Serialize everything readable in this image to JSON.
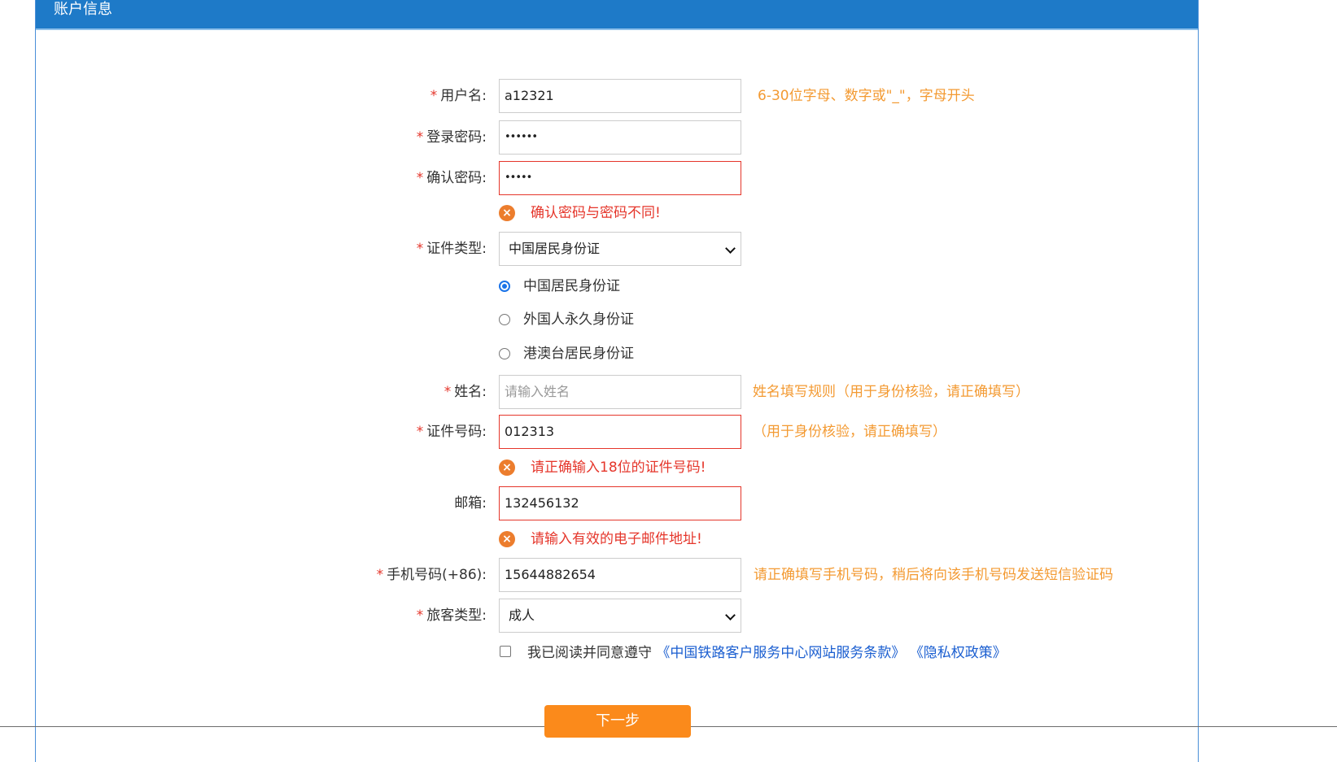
{
  "header": {
    "title": "账户信息"
  },
  "form": {
    "username": {
      "label": "用户名:",
      "value": "a12321",
      "hint": "6-30位字母、数字或\"_\"，字母开头"
    },
    "password": {
      "label": "登录密码:",
      "value": "••••••"
    },
    "confirm_password": {
      "label": "确认密码:",
      "value": "•••••",
      "error": "确认密码与密码不同!"
    },
    "id_type": {
      "label": "证件类型:",
      "value": "中国居民身份证",
      "options": [
        "中国居民身份证",
        "外国人永久身份证",
        "港澳台居民身份证"
      ],
      "selected_index": 0
    },
    "name": {
      "label": "姓名:",
      "placeholder": "请输入姓名",
      "hint": "姓名填写规则（用于身份核验，请正确填写）"
    },
    "id_number": {
      "label": "证件号码:",
      "value": "012313",
      "hint": "（用于身份核验，请正确填写）",
      "error": "请正确输入18位的证件号码!"
    },
    "email": {
      "label": "邮箱:",
      "value": "132456132",
      "error": "请输入有效的电子邮件地址!"
    },
    "phone": {
      "label": "手机号码(+86):",
      "value": "15644882654",
      "hint": "请正确填写手机号码，稍后将向该手机号码发送短信验证码"
    },
    "passenger_type": {
      "label": "旅客类型:",
      "value": "成人"
    },
    "agreement": {
      "text": "我已阅读并同意遵守",
      "link_terms": "《中国铁路客户服务中心网站服务条款》",
      "link_privacy": "《隐私权政策》",
      "checked": false
    },
    "required_mark": "*",
    "error_icon": "×",
    "next_button": "下一步"
  },
  "colors": {
    "header_bg": "#1e7ac8",
    "hint": "#f39a32",
    "error": "#e5362b",
    "link": "#1a5ed0",
    "button": "#fb8a1b"
  }
}
